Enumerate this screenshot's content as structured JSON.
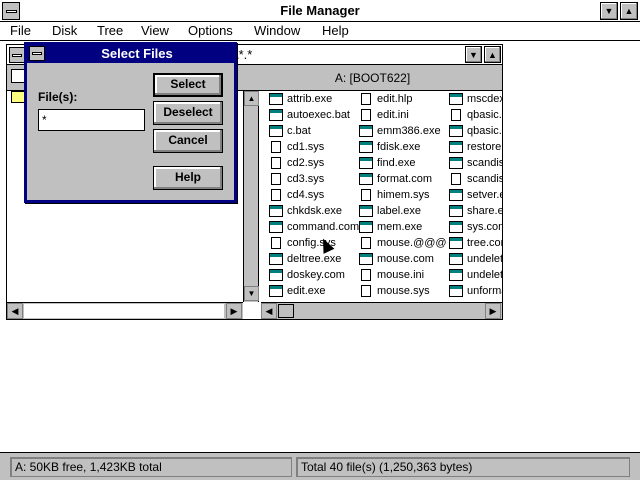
{
  "app": {
    "title": "File Manager",
    "minimize_icon": "triangle-down-icon",
    "maximize_icon": "triangle-up-icon"
  },
  "menu": [
    "File",
    "Disk",
    "Tree",
    "View",
    "Options",
    "Window",
    "Help"
  ],
  "dir_window": {
    "title": "\\*.*",
    "drive_label": "A: [BOOT622]"
  },
  "files": [
    [
      "attrib.exe",
      "exe"
    ],
    [
      "autoexec.bat",
      "exe"
    ],
    [
      "c.bat",
      "exe"
    ],
    [
      "cd1.sys",
      "doc"
    ],
    [
      "cd2.sys",
      "doc"
    ],
    [
      "cd3.sys",
      "doc"
    ],
    [
      "cd4.sys",
      "doc"
    ],
    [
      "chkdsk.exe",
      "exe"
    ],
    [
      "command.com",
      "exe"
    ],
    [
      "config.sys",
      "doc"
    ],
    [
      "deltree.exe",
      "exe"
    ],
    [
      "doskey.com",
      "exe"
    ],
    [
      "edit.exe",
      "exe"
    ],
    [
      "edit.hlp",
      "doc"
    ],
    [
      "edit.ini",
      "doc"
    ],
    [
      "emm386.exe",
      "exe"
    ],
    [
      "fdisk.exe",
      "exe"
    ],
    [
      "find.exe",
      "exe"
    ],
    [
      "format.com",
      "exe"
    ],
    [
      "himem.sys",
      "doc"
    ],
    [
      "label.exe",
      "exe"
    ],
    [
      "mem.exe",
      "exe"
    ],
    [
      "mouse.@@@",
      "doc"
    ],
    [
      "mouse.com",
      "exe"
    ],
    [
      "mouse.ini",
      "doc"
    ],
    [
      "mouse.sys",
      "doc"
    ],
    [
      "mscdex.",
      "exe"
    ],
    [
      "qbasic.",
      "doc"
    ],
    [
      "qbasic.h",
      "exe"
    ],
    [
      "restore.e",
      "exe"
    ],
    [
      "scandis",
      "exe"
    ],
    [
      "scandis",
      "doc"
    ],
    [
      "setver.e",
      "exe"
    ],
    [
      "share.ex",
      "exe"
    ],
    [
      "sys.com",
      "exe"
    ],
    [
      "tree.com",
      "exe"
    ],
    [
      "undelete",
      "exe"
    ],
    [
      "undelete",
      "exe"
    ],
    [
      "unforma",
      "exe"
    ]
  ],
  "dialog": {
    "title": "Select Files",
    "files_label": "File(s):",
    "files_value": "*",
    "select_label": "Select",
    "deselect_label": "Deselect",
    "cancel_label": "Cancel",
    "help_label": "Help"
  },
  "status": {
    "left": "A: 50KB free,  1,423KB total",
    "right": "Total 40 file(s) (1,250,363 bytes)"
  }
}
